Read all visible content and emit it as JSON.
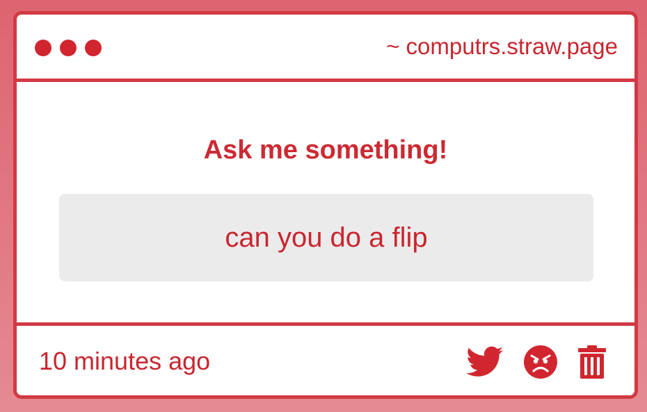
{
  "colors": {
    "accent": "#d13a43",
    "text": "#c8262f",
    "box_bg": "#ecebec",
    "outer_bg": "#dd6470"
  },
  "window": {
    "dots": [
      "window-dot",
      "window-dot",
      "window-dot"
    ],
    "url": "~ computrs.straw.page"
  },
  "main": {
    "title": "Ask me something!",
    "question": "can you do a flip"
  },
  "footer": {
    "timestamp": "10 minutes ago",
    "actions": [
      {
        "icon": "twitter-bird-icon"
      },
      {
        "icon": "angry-face-icon"
      },
      {
        "icon": "trash-can-icon"
      }
    ]
  }
}
